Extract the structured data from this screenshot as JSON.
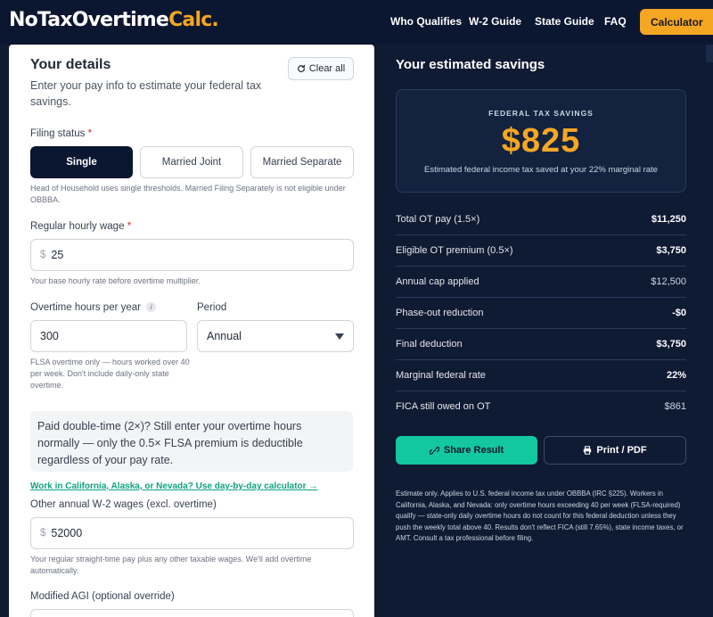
{
  "header": {
    "logo_main": "NoTaxOvertime",
    "logo_accent": "Calc.",
    "nav": [
      "Who Qualifies",
      "W-2 Guide",
      "State Guide",
      "FAQ"
    ],
    "cta": "Calculator"
  },
  "form": {
    "title": "Your details",
    "subtitle": "Enter your pay info to estimate your federal tax savings.",
    "clear_label": "Clear all",
    "filing_status": {
      "label": "Filing status",
      "required": "*",
      "options": [
        "Single",
        "Married Joint",
        "Married Separate"
      ],
      "selected": "Single",
      "help": "Head of Household uses single thresholds. Married Filing Separately is not eligible under OBBBA."
    },
    "hourly_wage": {
      "label": "Regular hourly wage",
      "required": "*",
      "currency": "$",
      "value": "25",
      "help": "Your base hourly rate before overtime multiplier."
    },
    "ot_hours": {
      "label": "Overtime hours per year",
      "info": "i",
      "value": "300",
      "help": "FLSA overtime only — hours worked over 40 per week. Don't include daily-only state overtime."
    },
    "period": {
      "label": "Period",
      "value": "Annual"
    },
    "note": "Paid double-time (2×)? Still enter your overtime hours normally — only the 0.5× FLSA premium is deductible regardless of your pay rate.",
    "state_link": "Work in California, Alaska, or Nevada? Use day-by-day calculator →",
    "other_wages": {
      "label": "Other annual W-2 wages (excl. overtime)",
      "currency": "$",
      "value": "52000",
      "help": "Your regular straight-time pay plus any other taxable wages. We'll add overtime automatically."
    },
    "magi": {
      "label": "Modified AGI (optional override)"
    }
  },
  "results": {
    "title": "Your estimated savings",
    "savings_label": "FEDERAL TAX SAVINGS",
    "savings_amount": "$825",
    "savings_desc": "Estimated federal income tax saved at your 22% marginal rate",
    "rows": [
      {
        "k": "Total OT pay (1.5×)",
        "v": "$11,250"
      },
      {
        "k": "Eligible OT premium (0.5×)",
        "v": "$3,750"
      },
      {
        "k": "Annual cap applied",
        "v": "$12,500"
      },
      {
        "k": "Phase-out reduction",
        "v": "-$0"
      },
      {
        "k": "Final deduction",
        "v": "$3,750"
      },
      {
        "k": "Marginal federal rate",
        "v": "22%"
      },
      {
        "k": "FICA still owed on OT",
        "v": "$861"
      }
    ],
    "share_label": "Share Result",
    "print_label": "Print / PDF",
    "disclaimer": "Estimate only. Applies to U.S. federal income tax under OBBBA (IRC §225). Workers in California, Alaska, and Nevada: only overtime hours exceeding 40 per week (FLSA-required) qualify — state-only daily overtime hours do not count for this federal deduction unless they push the weekly total above 40. Results don't reflect FICA (still 7.65%), state income taxes, or AMT. Consult a tax professional before filing."
  },
  "colors": {
    "navy": "#0b1730",
    "accent": "#f5a623",
    "teal": "#13c7a0"
  }
}
